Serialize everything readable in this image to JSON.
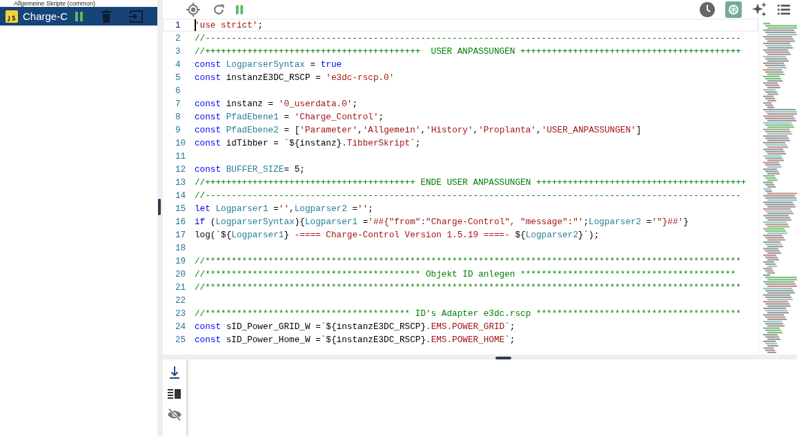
{
  "sidebar": {
    "partial_item": "Allgemeine Skripte (common)",
    "items": [
      {
        "label": "Charge-C",
        "selected": true
      }
    ]
  },
  "editor": {
    "lines": [
      {
        "number": "1",
        "current": true,
        "tokens": [
          {
            "kind": "string",
            "text": "'use strict'"
          },
          {
            "kind": "plain",
            "text": ";"
          }
        ]
      },
      {
        "number": "2",
        "current": false,
        "tokens": [
          {
            "kind": "comment",
            "text": "//------------------------------------------------------------------------------------------------------"
          }
        ]
      },
      {
        "number": "3",
        "current": false,
        "tokens": [
          {
            "kind": "comment",
            "text": "//+++++++++++++++++++++++++++++++++++++++++  USER ANPASSUNGEN ++++++++++++++++++++++++++++++++++++++++++"
          }
        ]
      },
      {
        "number": "4",
        "current": false,
        "tokens": [
          {
            "kind": "keyword",
            "text": "const "
          },
          {
            "kind": "identifier",
            "text": "LogparserSyntax"
          },
          {
            "kind": "plain",
            "text": " = "
          },
          {
            "kind": "keyword",
            "text": "true"
          }
        ]
      },
      {
        "number": "5",
        "current": false,
        "tokens": [
          {
            "kind": "keyword",
            "text": "const"
          },
          {
            "kind": "plain",
            "text": " instanzE3DC_RSCP = "
          },
          {
            "kind": "string",
            "text": "'e3dc-rscp.0'"
          }
        ]
      },
      {
        "number": "6",
        "current": false
      },
      {
        "number": "7",
        "current": false,
        "tokens": [
          {
            "kind": "keyword",
            "text": "const"
          },
          {
            "kind": "plain",
            "text": " instanz = "
          },
          {
            "kind": "string",
            "text": "'0_userdata.0'"
          },
          {
            "kind": "plain",
            "text": ";"
          }
        ]
      },
      {
        "number": "8",
        "current": false,
        "tokens": [
          {
            "kind": "keyword",
            "text": "const "
          },
          {
            "kind": "identifier",
            "text": "PfadEbene1"
          },
          {
            "kind": "plain",
            "text": " = "
          },
          {
            "kind": "string",
            "text": "'Charge_Control'"
          },
          {
            "kind": "plain",
            "text": ";"
          }
        ]
      },
      {
        "number": "9",
        "current": false,
        "tokens": [
          {
            "kind": "keyword",
            "text": "const "
          },
          {
            "kind": "identifier",
            "text": "PfadEbene2"
          },
          {
            "kind": "plain",
            "text": " = ["
          },
          {
            "kind": "string",
            "text": "'Parameter'"
          },
          {
            "kind": "plain",
            "text": ","
          },
          {
            "kind": "string",
            "text": "'Allgemein'"
          },
          {
            "kind": "plain",
            "text": ","
          },
          {
            "kind": "string",
            "text": "'History'"
          },
          {
            "kind": "plain",
            "text": ","
          },
          {
            "kind": "string",
            "text": "'Proplanta'"
          },
          {
            "kind": "plain",
            "text": ","
          },
          {
            "kind": "string",
            "text": "'USER_ANPASSUNGEN'"
          },
          {
            "kind": "plain",
            "text": "]"
          }
        ]
      },
      {
        "number": "10",
        "current": false,
        "tokens": [
          {
            "kind": "keyword",
            "text": "const"
          },
          {
            "kind": "plain",
            "text": " idTibber = `${instanz}"
          },
          {
            "kind": "string",
            "text": ".TibberSkript"
          },
          {
            "kind": "plain",
            "text": "`;"
          }
        ]
      },
      {
        "number": "11",
        "current": false
      },
      {
        "number": "12",
        "current": false,
        "tokens": [
          {
            "kind": "keyword",
            "text": "const "
          },
          {
            "kind": "identifier",
            "text": "BUFFER_SIZE"
          },
          {
            "kind": "plain",
            "text": "= 5;"
          }
        ]
      },
      {
        "number": "13",
        "current": false,
        "tokens": [
          {
            "kind": "comment",
            "text": "//++++++++++++++++++++++++++++++++++++++++ ENDE USER ANPASSUNGEN ++++++++++++++++++++++++++++++++++++++++"
          }
        ]
      },
      {
        "number": "14",
        "current": false,
        "tokens": [
          {
            "kind": "comment",
            "text": "//------------------------------------------------------------------------------------------------------"
          }
        ]
      },
      {
        "number": "15",
        "current": false,
        "tokens": [
          {
            "kind": "keyword",
            "text": "let "
          },
          {
            "kind": "identifier",
            "text": "Logparser1"
          },
          {
            "kind": "plain",
            "text": " ="
          },
          {
            "kind": "string",
            "text": "''"
          },
          {
            "kind": "plain",
            "text": ","
          },
          {
            "kind": "identifier",
            "text": "Logparser2"
          },
          {
            "kind": "plain",
            "text": " ="
          },
          {
            "kind": "string",
            "text": "''"
          },
          {
            "kind": "plain",
            "text": ";"
          }
        ]
      },
      {
        "number": "16",
        "current": false,
        "tokens": [
          {
            "kind": "keyword",
            "text": "if"
          },
          {
            "kind": "plain",
            "text": " ("
          },
          {
            "kind": "identifier",
            "text": "LogparserSyntax"
          },
          {
            "kind": "plain",
            "text": "){"
          },
          {
            "kind": "identifier",
            "text": "Logparser1"
          },
          {
            "kind": "plain",
            "text": " ="
          },
          {
            "kind": "string",
            "text": "'##{\"from\":\"Charge-Control\", \"message\":\"'"
          },
          {
            "kind": "plain",
            "text": ";"
          },
          {
            "kind": "identifier",
            "text": "Logparser2"
          },
          {
            "kind": "plain",
            "text": " ="
          },
          {
            "kind": "string",
            "text": "'\"}##'"
          },
          {
            "kind": "plain",
            "text": "}"
          }
        ]
      },
      {
        "number": "17",
        "current": false,
        "tokens": [
          {
            "kind": "plain",
            "text": "log(`${"
          },
          {
            "kind": "identifier",
            "text": "Logparser1"
          },
          {
            "kind": "plain",
            "text": "}"
          },
          {
            "kind": "string",
            "text": " -==== Charge-Control Version 1.5.19 ====- "
          },
          {
            "kind": "plain",
            "text": "${"
          },
          {
            "kind": "identifier",
            "text": "Logparser2"
          },
          {
            "kind": "plain",
            "text": "}`);"
          }
        ]
      },
      {
        "number": "18",
        "current": false
      },
      {
        "number": "19",
        "current": false,
        "tokens": [
          {
            "kind": "comment",
            "text": "//******************************************************************************************************"
          }
        ]
      },
      {
        "number": "20",
        "current": false,
        "tokens": [
          {
            "kind": "comment",
            "text": "//***************************************** Objekt ID anlegen *****************************************"
          }
        ]
      },
      {
        "number": "21",
        "current": false,
        "tokens": [
          {
            "kind": "comment",
            "text": "//******************************************************************************************************"
          }
        ]
      },
      {
        "number": "22",
        "current": false
      },
      {
        "number": "23",
        "current": false,
        "tokens": [
          {
            "kind": "comment",
            "text": "//*************************************** ID's Adapter e3dc.rscp ***************************************"
          }
        ]
      },
      {
        "number": "24",
        "current": false,
        "tokens": [
          {
            "kind": "keyword",
            "text": "const"
          },
          {
            "kind": "plain",
            "text": " sID_Power_GRID_W =`${instanzE3DC_RSCP}"
          },
          {
            "kind": "string",
            "text": ".EMS.POWER_GRID"
          },
          {
            "kind": "plain",
            "text": "`;"
          }
        ]
      },
      {
        "number": "25",
        "current": false,
        "tokens": [
          {
            "kind": "keyword",
            "text": "const"
          },
          {
            "kind": "plain",
            "text": " sID_Power_Home_W =`${instanzE3DC_RSCP}"
          },
          {
            "kind": "string",
            "text": ".EMS.POWER_HOME"
          },
          {
            "kind": "plain",
            "text": "`;"
          }
        ]
      }
    ]
  }
}
